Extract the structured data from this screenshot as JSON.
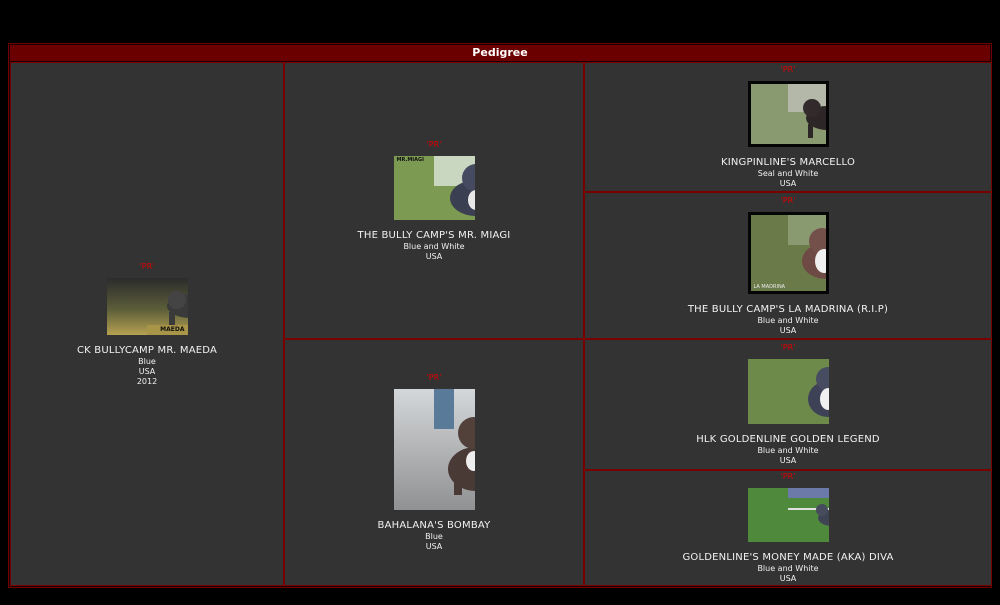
{
  "header": {
    "title": "Pedigree"
  },
  "dogs": {
    "maeda": {
      "badge": "'PR'",
      "name": "CK BULLYCAMP MR. MAEDA",
      "color": "Blue",
      "country": "USA",
      "year": "2012",
      "photo_caption": "MAEDA"
    },
    "miagi": {
      "badge": "'PR'",
      "name": "THE BULLY CAMP'S MR. MIAGI",
      "color": "Blue and White",
      "country": "USA",
      "photo_caption": "MR.MIAGI"
    },
    "bombay": {
      "badge": "'PR'",
      "name": "BAHALANA'S BOMBAY",
      "color": "Blue",
      "country": "USA"
    },
    "marcello": {
      "badge": "'PR'",
      "name": "KINGPINLINE'S MARCELLO",
      "color": "Seal and White",
      "country": "USA"
    },
    "madrina": {
      "badge": "'PR'",
      "name": "THE BULLY CAMP'S LA MADRINA (R.I.P)",
      "color": "Blue and White",
      "country": "USA",
      "photo_caption": "LA MADRINA"
    },
    "legend": {
      "badge": "'PR'",
      "name": "HLK GOLDENLINE GOLDEN LEGEND",
      "color": "Blue and White",
      "country": "USA"
    },
    "diva": {
      "badge": "'PR'",
      "name": "GOLDENLINE'S MONEY MADE (AKA) DIVA",
      "color": "Blue and White",
      "country": "USA"
    }
  }
}
